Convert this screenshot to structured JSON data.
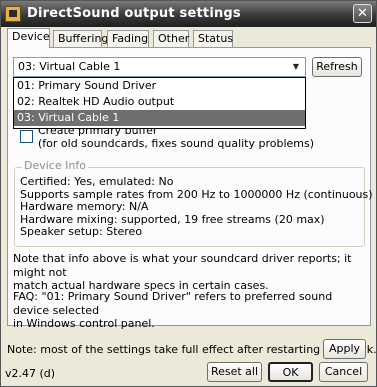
{
  "window": {
    "title": "DirectSound output settings",
    "close_label": "✕"
  },
  "tabs": [
    {
      "label": "Device"
    },
    {
      "label": "Buffering"
    },
    {
      "label": "Fading"
    },
    {
      "label": "Other"
    },
    {
      "label": "Status"
    }
  ],
  "device": {
    "selected": "03: Virtual Cable 1",
    "refresh_label": "Refresh",
    "options": [
      {
        "label": "01: Primary Sound Driver"
      },
      {
        "label": "02: Realtek HD Audio output"
      },
      {
        "label": "03: Virtual Cable 1"
      }
    ]
  },
  "create_primary_buffer": {
    "label_line1": "Create primary buffer",
    "label_line2": "(for old soundcards, fixes sound quality problems)"
  },
  "device_info": {
    "title": "Device Info",
    "lines": [
      "Certified: Yes, emulated: No",
      "Supports sample rates from 200 Hz to 1000000 Hz (continuous)",
      "Hardware memory: N/A",
      "Hardware mixing: supported, 19 free streams (20 max)",
      "Speaker setup: Stereo"
    ]
  },
  "notes": {
    "info_line1": "Note that info above is what your soundcard driver reports; it might not",
    "info_line2": "match actual hardware specs in certain cases.",
    "faq_line1": "FAQ: \"01: Primary Sound Driver\" refers to preferred sound device selected",
    "faq_line2": "in Windows control panel."
  },
  "footer": {
    "note": "Note: most of the settings take full effect after restarting playback.",
    "apply_label": "Apply",
    "version": "v2.47 (d)",
    "reset_label": "Reset all",
    "ok_label": "OK",
    "cancel_label": "Cancel"
  }
}
